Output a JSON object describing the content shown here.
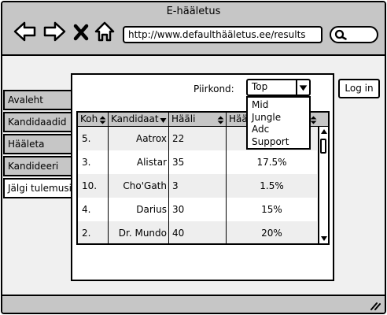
{
  "window": {
    "title": "E-hääletus"
  },
  "browser": {
    "url": "http://www.defaulthääletus.ee/results",
    "buttons": {
      "back": "back-arrow-icon",
      "forward": "forward-arrow-icon",
      "stop": "close-icon",
      "home": "home-icon",
      "search": "search-icon"
    }
  },
  "sidebar": {
    "tabs": [
      {
        "label": "Avaleht"
      },
      {
        "label": "Kandidaadid"
      },
      {
        "label": "Hääleta"
      },
      {
        "label": "Kandideeri"
      },
      {
        "label": "Jälgi tulemusi",
        "active": true
      }
    ]
  },
  "header": {
    "login_label": "Log in"
  },
  "filter": {
    "label": "Piirkond:",
    "selected": "Top",
    "options": [
      "Mid",
      "Jungle",
      "Adc",
      "Support"
    ]
  },
  "table": {
    "columns": [
      "Koh",
      "Kandidaat",
      "Hääli",
      "Hää"
    ],
    "rows": [
      {
        "rank": "5.",
        "name": "Aatrox",
        "votes": "22",
        "percent": ""
      },
      {
        "rank": "3.",
        "name": "Alistar",
        "votes": "35",
        "percent": "17.5%"
      },
      {
        "rank": "10.",
        "name": "Cho'Gath",
        "votes": "3",
        "percent": "1.5%"
      },
      {
        "rank": "4.",
        "name": "Darius",
        "votes": "30",
        "percent": "15%"
      },
      {
        "rank": "2.",
        "name": "Dr. Mundo",
        "votes": "40",
        "percent": "20%"
      }
    ]
  },
  "colors": {
    "chrome": "#c6c6c6",
    "row_alt": "#eeeeee",
    "border": "#000000"
  }
}
